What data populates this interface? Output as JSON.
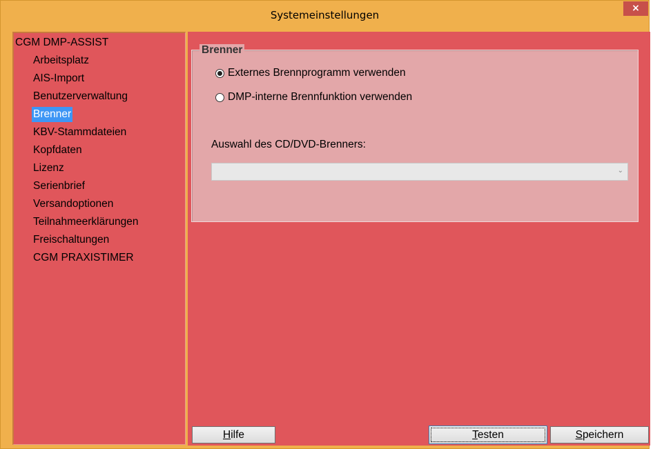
{
  "window": {
    "title": "Systemeinstellungen",
    "close_label": "×",
    "accent_color": "#f0b04c",
    "panel_color": "#e0565b"
  },
  "tree": {
    "root": "CGM DMP-ASSIST",
    "items": [
      {
        "label": "Arbeitsplatz"
      },
      {
        "label": "AIS-Import"
      },
      {
        "label": "Benutzerverwaltung"
      },
      {
        "label": "Brenner",
        "selected": true
      },
      {
        "label": "KBV-Stammdateien"
      },
      {
        "label": "Kopfdaten"
      },
      {
        "label": "Lizenz"
      },
      {
        "label": "Serienbrief"
      },
      {
        "label": "Versandoptionen"
      },
      {
        "label": "Teilnahmeerklärungen"
      },
      {
        "label": "Freischaltungen"
      },
      {
        "label": "CGM PRAXISTIMER"
      }
    ]
  },
  "brenner": {
    "legend": "Brenner",
    "options": [
      {
        "label": "Externes Brennprogramm verwenden",
        "checked": true
      },
      {
        "label": "DMP-interne Brennfunktion verwenden",
        "checked": false
      }
    ],
    "select_label": "Auswahl des CD/DVD-Brenners:",
    "select_value": ""
  },
  "buttons": {
    "help_mnemonic": "H",
    "help_rest": "ilfe",
    "test_mnemonic": "T",
    "test_rest": "esten",
    "save_mnemonic": "S",
    "save_rest": "peichern"
  }
}
